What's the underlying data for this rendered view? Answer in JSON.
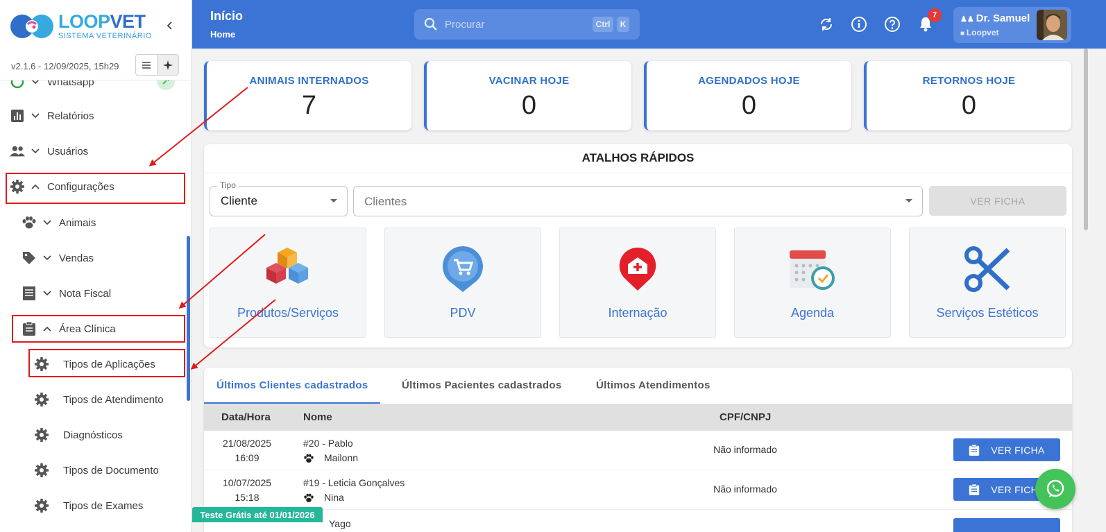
{
  "brand": {
    "name_part1": "LOOP",
    "name_part2": "VET",
    "tagline": "SISTEMA VETERINÁRIO",
    "version": "v2.1.6 - 12/09/2025, 15h29"
  },
  "sidebar": {
    "items": [
      {
        "label": "Whatsapp",
        "icon": "whatsapp-icon"
      },
      {
        "label": "Relatórios",
        "icon": "bar-chart-icon"
      },
      {
        "label": "Usuários",
        "icon": "people-icon"
      },
      {
        "label": "Configurações",
        "icon": "gear-icon"
      },
      {
        "label": "Animais",
        "icon": "paw-icon"
      },
      {
        "label": "Vendas",
        "icon": "tag-icon"
      },
      {
        "label": "Nota Fiscal",
        "icon": "receipt-icon"
      },
      {
        "label": "Área Clínica",
        "icon": "clipboard-icon"
      },
      {
        "label": "Tipos de Aplicações",
        "icon": "gear-icon"
      },
      {
        "label": "Tipos de Atendimento",
        "icon": "gear-icon"
      },
      {
        "label": "Diagnósticos",
        "icon": "gear-icon"
      },
      {
        "label": "Tipos de Documento",
        "icon": "gear-icon"
      },
      {
        "label": "Tipos de Exames",
        "icon": "gear-icon"
      }
    ]
  },
  "header": {
    "title": "Início",
    "breadcrumb": "Home",
    "search_placeholder": "Procurar",
    "kbd1": "Ctrl",
    "kbd2": "K",
    "notifications": "7",
    "user_name": "Dr. Samuel",
    "user_org": "Loopvet"
  },
  "stats": [
    {
      "label": "ANIMAIS INTERNADOS",
      "value": "7"
    },
    {
      "label": "VACINAR HOJE",
      "value": "0"
    },
    {
      "label": "AGENDADOS HOJE",
      "value": "0"
    },
    {
      "label": "RETORNOS HOJE",
      "value": "0"
    }
  ],
  "quick": {
    "title": "ATALHOS RÁPIDOS",
    "tipo_label": "Tipo",
    "tipo_value": "Cliente",
    "clientes_placeholder": "Clientes",
    "ver_ficha": "VER FICHA",
    "tiles": [
      {
        "label": "Produtos/Serviços",
        "icon": "boxes-icon"
      },
      {
        "label": "PDV",
        "icon": "cart-icon"
      },
      {
        "label": "Internação",
        "icon": "hospital-icon"
      },
      {
        "label": "Agenda",
        "icon": "calendar-clock-icon"
      },
      {
        "label": "Serviços Estéticos",
        "icon": "scissors-icon"
      }
    ]
  },
  "tabs": {
    "items": [
      "Últimos Clientes cadastrados",
      "Últimos Pacientes cadastrados",
      "Últimos Atendimentos"
    ],
    "columns": {
      "date": "Data/Hora",
      "name": "Nome",
      "cpf": "CPF/CNPJ"
    },
    "rows": [
      {
        "date": "21/08/2025",
        "time": "16:09",
        "name": "#20 - Pablo",
        "pet": "Mailonn",
        "cpf": "Não informado",
        "action": "VER FICHA"
      },
      {
        "date": "10/07/2025",
        "time": "15:18",
        "name": "#19 - Leticia Gonçalves",
        "pet": "Nina",
        "cpf": "Não informado",
        "action": "VER FICHA"
      },
      {
        "date": "",
        "time": "",
        "name": "",
        "pet": "Yago",
        "cpf": "",
        "action": ""
      }
    ]
  },
  "trial_badge": "Teste Grátis até 01/01/2026",
  "colors": {
    "primary": "#3b74d4",
    "annotation": "#e01b1b",
    "whatsapp": "#43c35a"
  }
}
